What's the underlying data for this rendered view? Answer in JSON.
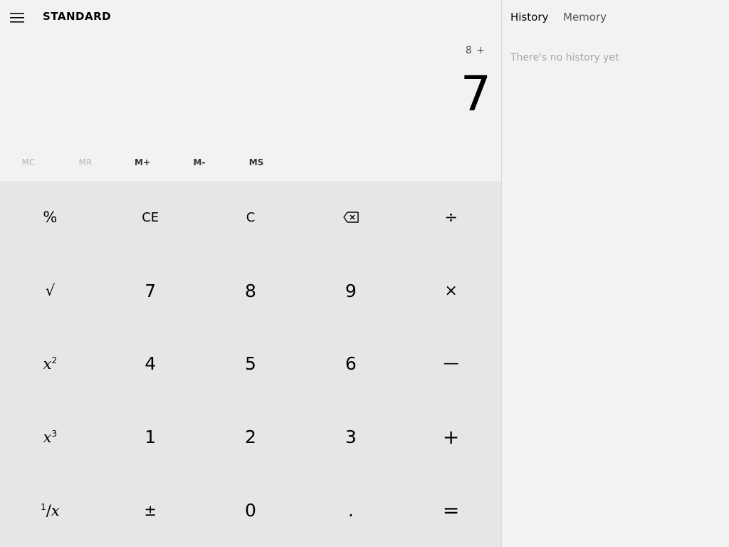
{
  "header": {
    "mode_title": "STANDARD"
  },
  "display": {
    "expression": "8 +",
    "result": "7"
  },
  "memory": [
    {
      "label": "MC",
      "enabled": false
    },
    {
      "label": "MR",
      "enabled": false
    },
    {
      "label": "M+",
      "enabled": true
    },
    {
      "label": "M-",
      "enabled": true
    },
    {
      "label": "MS",
      "enabled": true
    }
  ],
  "keys": {
    "percent": "%",
    "ce": "CE",
    "c": "C",
    "divide": "÷",
    "sqrt": "√",
    "seven": "7",
    "eight": "8",
    "nine": "9",
    "multiply": "×",
    "four": "4",
    "five": "5",
    "six": "6",
    "minus": "—",
    "one": "1",
    "two": "2",
    "three": "3",
    "plus": "+",
    "negate": "±",
    "zero": "0",
    "decimal": ".",
    "equals": "="
  },
  "side_panel": {
    "tabs": [
      "History",
      "Memory"
    ],
    "active_tab": "History",
    "empty_message": "There's no history yet"
  },
  "icons": {
    "menu": "hamburger-menu-icon",
    "backspace": "backspace-icon"
  }
}
